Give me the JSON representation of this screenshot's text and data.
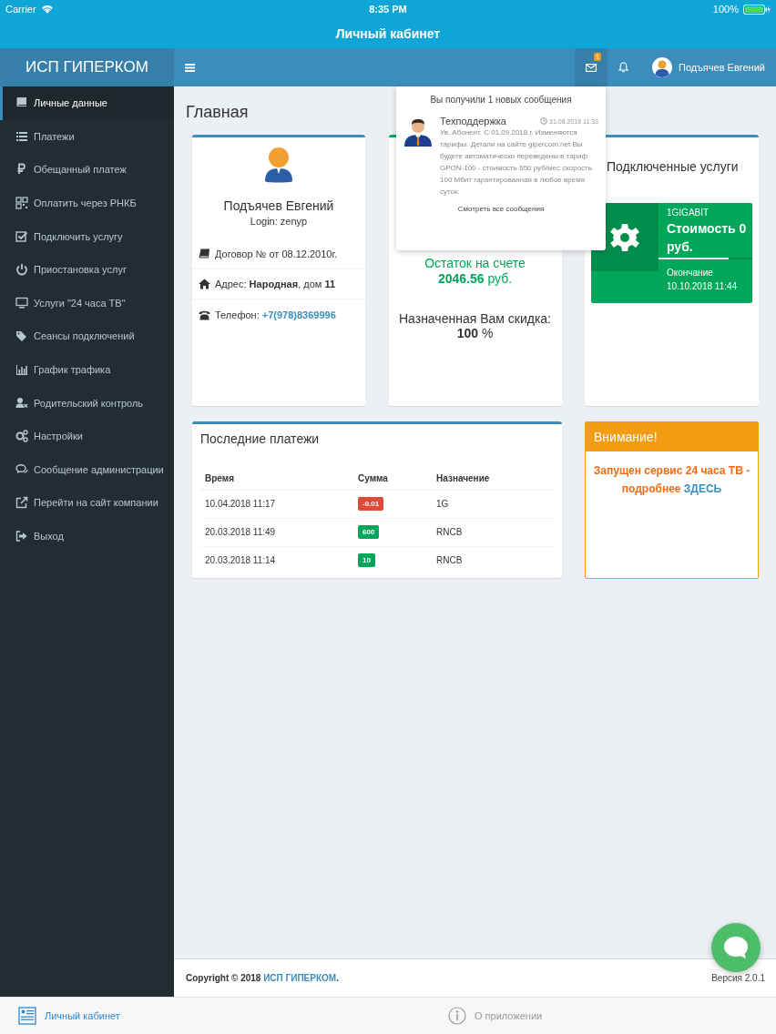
{
  "status_bar": {
    "carrier": "Carrier",
    "time": "8:35 PM",
    "battery": "100%"
  },
  "app_title": "Личный кабинет",
  "header": {
    "logo": "ИСП ГИПЕРКОМ",
    "messages_badge": "1",
    "user_name": "Подъячев Евгений"
  },
  "sidebar": {
    "items": [
      {
        "label": "Личные данные",
        "selected": true
      },
      {
        "label": "Платежи",
        "selected": false
      },
      {
        "label": "Обещанный платеж",
        "selected": false
      },
      {
        "label": "Оплатить через РНКБ",
        "selected": false
      },
      {
        "label": "Подключить услугу",
        "selected": false
      },
      {
        "label": "Приостановка услуг",
        "selected": false
      },
      {
        "label": "Услуги \"24 часа ТВ\"",
        "selected": false
      },
      {
        "label": "Сеансы подключений",
        "selected": false
      },
      {
        "label": "График трафика",
        "selected": false
      },
      {
        "label": "Родительский контроль",
        "selected": false
      },
      {
        "label": "Настройки",
        "selected": false
      },
      {
        "label": "Сообщение администрации",
        "selected": false
      },
      {
        "label": "Перейти на сайт компании",
        "selected": false
      },
      {
        "label": "Выход",
        "selected": false
      }
    ]
  },
  "page_title": "Главная",
  "profile": {
    "name": "Подъячев Евгений",
    "login": "Login: zenyp",
    "contract": "Договор №  от 08.12.2010г.",
    "address": "Адрес: **Народная**, дом **11**",
    "phone_label": "Телефон:",
    "phone": "+7(978)8369996"
  },
  "balance": {
    "text": "Остаток на счете **2046.56** руб.",
    "discount_label": "Назначенная Вам скидка:",
    "discount": "**100** %"
  },
  "services": {
    "title": "Подключенные услуги",
    "items": [
      {
        "name": "1GIGABIT",
        "cost": "Стоимость 0 руб.",
        "level": 0.75,
        "end_label": "Окончание",
        "end_date": "10.10.2018 11:44"
      }
    ]
  },
  "payments": {
    "title": "Последние платежи",
    "columns": [
      "Время",
      "Сумма",
      "Назначение"
    ],
    "rows": [
      {
        "time": "10.04.2018 11:17",
        "amount": "-0.01",
        "color": "#dd4b39",
        "purpose": "1G"
      },
      {
        "time": "20.03.2018 11:49",
        "amount": "600",
        "color": "#00a65a",
        "purpose": "RNCB"
      },
      {
        "time": "20.03.2018 11:14",
        "amount": "10",
        "color": "#00a65a",
        "purpose": "RNCB"
      }
    ]
  },
  "notice": {
    "title": "Внимание!",
    "text": "Запущен сервис 24 часа ТВ - подробнее",
    "link": "ЗДЕСЬ"
  },
  "notifications": {
    "open": true,
    "header": "Вы получили 1 новых сообщения",
    "messages": [
      {
        "sender": "Техподдержка",
        "time": "31.08.2018 11:33",
        "text": "Ув. Абонент. С 01.09.2018 г. Изменяются тарифы. Детали на сайте gipercom.net Вы будете автоматически переведены в тариф GPON-100 - стоимость 650 руб/мес скорость 100 Мбит гарантированная в любое время суток."
      }
    ],
    "footer": "Смотреть все сообщения"
  },
  "footer": {
    "copyright": "Copyright © 2018",
    "company": "ИСП ГИПЕРКОМ",
    "suffix": ".",
    "version": "Версия 2.0.1"
  },
  "tab_bar": {
    "tabs": [
      {
        "label": "Личный кабинет",
        "selected": true
      },
      {
        "label": "О приложении",
        "selected": false
      }
    ]
  }
}
